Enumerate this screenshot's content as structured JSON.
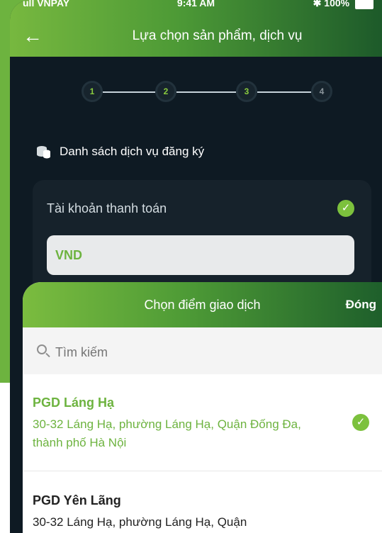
{
  "status": {
    "carrier": "ull VNPAY",
    "time": "9:41 AM",
    "battery": "100%"
  },
  "header": {
    "title": "Lựa chọn sản phẩm, dịch vụ"
  },
  "stepper": {
    "steps": [
      "1",
      "2",
      "3",
      "4"
    ]
  },
  "services": {
    "title": "Danh sách dịch vụ đăng ký",
    "account_label": "Tài khoản thanh toán",
    "currency": "VND"
  },
  "sheet": {
    "title": "Chọn điểm giao dịch",
    "close_label": "Đóng",
    "search_placeholder": "Tìm kiếm",
    "items": [
      {
        "name": "PGD Láng Hạ",
        "address": "30-32 Láng Hạ, phường Láng Hạ, Quận Đống Đa, thành phố Hà Nội",
        "selected": true
      },
      {
        "name": "PGD Yên Lãng",
        "address": "30-32 Láng Hạ, phường Láng Hạ, Quận"
      }
    ]
  },
  "colors": {
    "accent": "#6db33f",
    "dark": "#0e1a23",
    "card": "#16222b"
  },
  "icons": {
    "back": "arrow-left-icon",
    "search": "search-icon",
    "check": "check-circle-icon",
    "services": "coins-icon"
  }
}
